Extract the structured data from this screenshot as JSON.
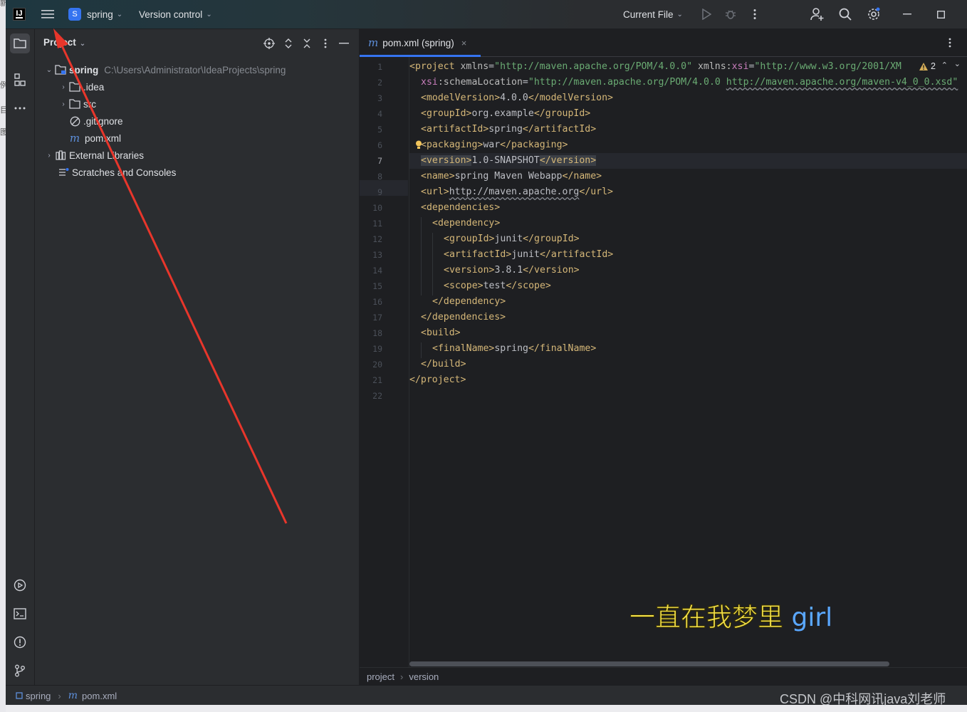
{
  "titlebar": {
    "app_logo": "IJ",
    "project_initial": "S",
    "project_name": "spring",
    "vcs_label": "Version control",
    "run_config": "Current File"
  },
  "project_panel": {
    "title": "Project",
    "tree": [
      {
        "label": "spring",
        "hint": "C:\\Users\\Administrator\\IdeaProjects\\spring"
      },
      {
        "label": ".idea"
      },
      {
        "label": "src"
      },
      {
        "label": ".gitignore"
      },
      {
        "label": "pom.xml"
      },
      {
        "label": "External Libraries"
      },
      {
        "label": "Scratches and Consoles"
      }
    ]
  },
  "editor": {
    "tab_label": "pom.xml (spring)",
    "warning_count": "2",
    "line_numbers": [
      "1",
      "2",
      "3",
      "4",
      "5",
      "6",
      "7",
      "8",
      "9",
      "10",
      "11",
      "12",
      "13",
      "14",
      "15",
      "16",
      "17",
      "18",
      "19",
      "20",
      "21",
      "22"
    ],
    "breadcrumbs": [
      "project",
      "version"
    ]
  },
  "code": {
    "l1_open": "<project ",
    "l1_attr1": "xmlns",
    "l1_val1": "\"http://maven.apache.org/POM/4.0.0\"",
    "l1_attr2a": "xmlns:",
    "l1_attr2b": "xsi",
    "l1_val2": "\"http://www.w3.org/2001/XM",
    "l2_ns": "xsi",
    "l2_attr": ":schemaLocation",
    "l2_val1": "\"http://maven.apache.org/POM/4.0.0 ",
    "l2_val2": "http://maven.apache.org/maven-v4_0_0.xsd\"",
    "l3": [
      "<modelVersion>",
      "4.0.0",
      "</modelVersion>"
    ],
    "l4": [
      "<groupId>",
      "org.example",
      "</groupId>"
    ],
    "l5": [
      "<artifactId>",
      "spring",
      "</artifactId>"
    ],
    "l6": [
      "<packaging>",
      "war",
      "</packaging>"
    ],
    "l7": [
      "<version>",
      "1.0-SNAPSHOT",
      "</version>"
    ],
    "l8": [
      "<name>",
      "spring Maven Webapp",
      "</name>"
    ],
    "l9": [
      "<url>",
      "http://maven.apache.org",
      "</url>"
    ],
    "l10": "<dependencies>",
    "l11": "<dependency>",
    "l12": [
      "<groupId>",
      "junit",
      "</groupId>"
    ],
    "l13": [
      "<artifactId>",
      "junit",
      "</artifactId>"
    ],
    "l14": [
      "<version>",
      "3.8.1",
      "</version>"
    ],
    "l15": [
      "<scope>",
      "test",
      "</scope>"
    ],
    "l16": "</dependency>",
    "l17": "</dependencies>",
    "l18": "<build>",
    "l19": [
      "<finalName>",
      "spring",
      "</finalName>"
    ],
    "l20": "</build>",
    "l21": "</project>"
  },
  "statusbar": {
    "project": "spring",
    "file": "pom.xml"
  },
  "overlay": {
    "lyric_cn": "一直在我梦里",
    "lyric_en": "girl",
    "watermark": "CSDN @中科网讯java刘老师"
  },
  "outer_window_glyphs": [
    "新",
    "例",
    "目",
    "图"
  ],
  "icons": [
    "intellij-logo",
    "hamburger-menu-icon",
    "run-icon",
    "debug-icon",
    "more-vertical-icon",
    "add-user-icon",
    "search-icon",
    "settings-icon",
    "minimize-icon",
    "maximize-icon",
    "folder-icon",
    "structure-icon",
    "more-horizontal-icon",
    "services-icon",
    "terminal-icon",
    "problems-icon",
    "git-icon",
    "locate-icon",
    "expand-collapse-icon",
    "close-icon",
    "hide-icon",
    "warning-icon",
    "lightbulb-icon"
  ],
  "colors": {
    "accent": "#3574f0",
    "tag": "#d5b778",
    "string": "#6aab73",
    "namespace": "#c77dbb",
    "annotation_arrow": "#e8362b"
  }
}
